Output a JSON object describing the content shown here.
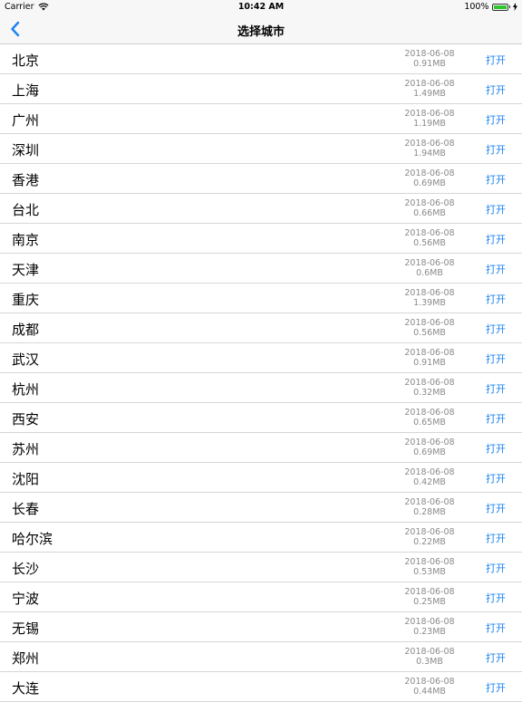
{
  "status_bar": {
    "carrier": "Carrier",
    "time": "10:42 AM",
    "battery": "100%",
    "battery_level": 1.0
  },
  "nav": {
    "title": "选择城市",
    "back_icon": "chevron-left-icon",
    "accent": "#1a82f0"
  },
  "cities": [
    {
      "name": "北京",
      "date": "2018-06-08",
      "size": "0.91MB",
      "action": "打开"
    },
    {
      "name": "上海",
      "date": "2018-06-08",
      "size": "1.49MB",
      "action": "打开"
    },
    {
      "name": "广州",
      "date": "2018-06-08",
      "size": "1.19MB",
      "action": "打开"
    },
    {
      "name": "深圳",
      "date": "2018-06-08",
      "size": "1.94MB",
      "action": "打开"
    },
    {
      "name": "香港",
      "date": "2018-06-08",
      "size": "0.69MB",
      "action": "打开"
    },
    {
      "name": "台北",
      "date": "2018-06-08",
      "size": "0.66MB",
      "action": "打开"
    },
    {
      "name": "南京",
      "date": "2018-06-08",
      "size": "0.56MB",
      "action": "打开"
    },
    {
      "name": "天津",
      "date": "2018-06-08",
      "size": "0.6MB",
      "action": "打开"
    },
    {
      "name": "重庆",
      "date": "2018-06-08",
      "size": "1.39MB",
      "action": "打开"
    },
    {
      "name": "成都",
      "date": "2018-06-08",
      "size": "0.56MB",
      "action": "打开"
    },
    {
      "name": "武汉",
      "date": "2018-06-08",
      "size": "0.91MB",
      "action": "打开"
    },
    {
      "name": "杭州",
      "date": "2018-06-08",
      "size": "0.32MB",
      "action": "打开"
    },
    {
      "name": "西安",
      "date": "2018-06-08",
      "size": "0.65MB",
      "action": "打开"
    },
    {
      "name": "苏州",
      "date": "2018-06-08",
      "size": "0.69MB",
      "action": "打开"
    },
    {
      "name": "沈阳",
      "date": "2018-06-08",
      "size": "0.42MB",
      "action": "打开"
    },
    {
      "name": "长春",
      "date": "2018-06-08",
      "size": "0.28MB",
      "action": "打开"
    },
    {
      "name": "哈尔滨",
      "date": "2018-06-08",
      "size": "0.22MB",
      "action": "打开"
    },
    {
      "name": "长沙",
      "date": "2018-06-08",
      "size": "0.53MB",
      "action": "打开"
    },
    {
      "name": "宁波",
      "date": "2018-06-08",
      "size": "0.25MB",
      "action": "打开"
    },
    {
      "name": "无锡",
      "date": "2018-06-08",
      "size": "0.23MB",
      "action": "打开"
    },
    {
      "name": "郑州",
      "date": "2018-06-08",
      "size": "0.3MB",
      "action": "打开"
    },
    {
      "name": "大连",
      "date": "2018-06-08",
      "size": "0.44MB",
      "action": "打开"
    }
  ]
}
